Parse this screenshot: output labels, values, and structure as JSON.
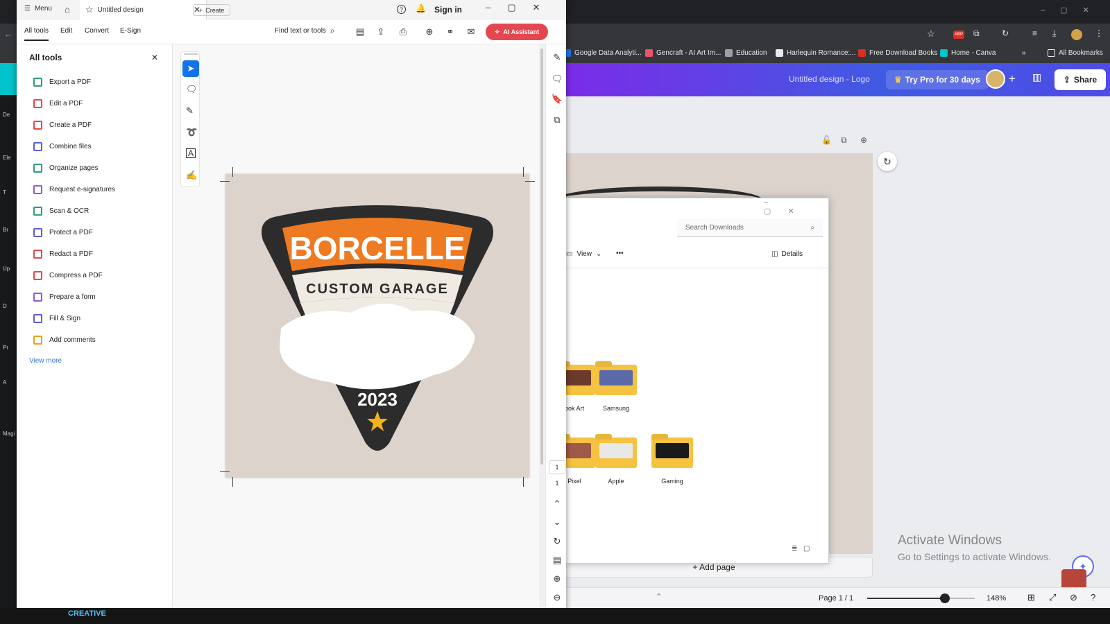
{
  "colors": {
    "accent": "#e34850",
    "canva_purple": "#7d2ae8",
    "logo_orange": "#ee7a22",
    "logo_dark": "#2c2c2c"
  },
  "chrome": {
    "bookmarks": [
      {
        "label": "Google Data Analyti...",
        "color": "#1a73e8"
      },
      {
        "label": "Gencraft - AI Art Im...",
        "color": "#e8556b"
      },
      {
        "label": "Education",
        "color": "#9aa0a6"
      },
      {
        "label": "Harlequin Romance:...",
        "color": "#e8eaed"
      },
      {
        "label": "Free Download Books",
        "color": "#d93025"
      },
      {
        "label": "Home - Canva",
        "color": "#00c4cc"
      }
    ],
    "overflow": "»",
    "all_bookmarks": "All Bookmarks"
  },
  "canva": {
    "title": "Untitled design - Logo",
    "try_pro": "Try Pro for 30 days",
    "share": "Share",
    "add_page": "+ Add page",
    "page_indicator": "Page 1 / 1",
    "zoom": "148%",
    "zoom_fraction": 0.72,
    "left_labels": [
      "De",
      "Ele",
      "T",
      "Br",
      "Up",
      "D",
      "Pr",
      "A",
      "Magi"
    ],
    "activation_title": "Activate Windows",
    "activation_sub": "Go to Settings to activate Windows.",
    "bottom_text": "CREATIVE"
  },
  "explorer": {
    "search_placeholder": "Search Downloads",
    "view": "View",
    "details": "Details",
    "more": "•••",
    "folders": [
      {
        "label": "ook Art",
        "color": "#6b3a2a"
      },
      {
        "label": "Samsung",
        "color": "#5a6aa8"
      },
      {
        "label": "Pixel",
        "color": "#a05a4a"
      },
      {
        "label": "Apple",
        "color": "#e8e8e8"
      },
      {
        "label": "Gaming",
        "color": "#1a1a1a"
      }
    ]
  },
  "acrobat": {
    "menu": "Menu",
    "tab_title": "Untitled design",
    "create": "Create",
    "sign_in": "Sign in",
    "tabs": [
      "All tools",
      "Edit",
      "Convert",
      "E-Sign"
    ],
    "find": "Find text or tools",
    "ai_assistant": "AI Assistant",
    "panel_title": "All tools",
    "view_more": "View more",
    "tools": [
      {
        "label": "Export a PDF",
        "color": "#2d9d78"
      },
      {
        "label": "Edit a PDF",
        "color": "#e34850"
      },
      {
        "label": "Create a PDF",
        "color": "#e34850"
      },
      {
        "label": "Combine files",
        "color": "#5c5ce0"
      },
      {
        "label": "Organize pages",
        "color": "#2d9d78"
      },
      {
        "label": "Request e-signatures",
        "color": "#9256d9"
      },
      {
        "label": "Scan & OCR",
        "color": "#2d9d78"
      },
      {
        "label": "Protect a PDF",
        "color": "#5c5ce0"
      },
      {
        "label": "Redact a PDF",
        "color": "#e34850"
      },
      {
        "label": "Compress a PDF",
        "color": "#e34850"
      },
      {
        "label": "Prepare a form",
        "color": "#9256d9"
      },
      {
        "label": "Fill & Sign",
        "color": "#5c5ce0"
      },
      {
        "label": "Add comments",
        "color": "#e8a317"
      }
    ],
    "page_current": "1",
    "page_total": "1"
  },
  "logo": {
    "brand": "BORCELLE",
    "sub": "CUSTOM GARAGE",
    "year": "2023"
  }
}
